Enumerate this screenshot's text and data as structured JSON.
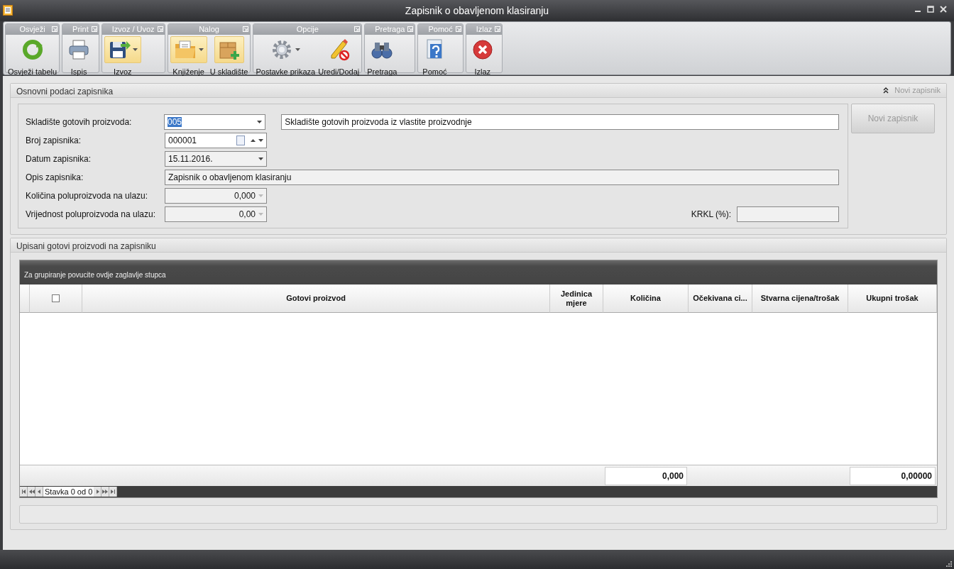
{
  "window": {
    "title": "Zapisnik o obavljenom klasiranju"
  },
  "ribbon": {
    "groups": [
      {
        "title": "Osvježi",
        "buttons": [
          {
            "label": "Osvježi tabelu",
            "kind": "refresh",
            "dropdown": false,
            "highlighted": false
          }
        ]
      },
      {
        "title": "Print",
        "buttons": [
          {
            "label": "Ispis",
            "kind": "printer",
            "dropdown": false,
            "highlighted": false
          }
        ]
      },
      {
        "title": "Izvoz / Uvoz",
        "buttons": [
          {
            "label": "Izvoz",
            "kind": "save",
            "dropdown": true,
            "highlighted": true
          }
        ]
      },
      {
        "title": "Nalog",
        "buttons": [
          {
            "label": "Knjiženje",
            "kind": "folder",
            "dropdown": true,
            "highlighted": true
          },
          {
            "label": "U skladište",
            "kind": "box",
            "dropdown": false,
            "highlighted": true
          }
        ]
      },
      {
        "title": "Opcije",
        "buttons": [
          {
            "label": "Postavke prikaza",
            "kind": "gear",
            "dropdown": true,
            "highlighted": false
          },
          {
            "label": "Uredi/Dodaj",
            "kind": "pencil",
            "dropdown": false,
            "highlighted": false
          }
        ]
      },
      {
        "title": "Pretraga",
        "buttons": [
          {
            "label": "Pretraga",
            "kind": "binoculars",
            "dropdown": false,
            "highlighted": false
          }
        ]
      },
      {
        "title": "Pomoć",
        "buttons": [
          {
            "label": "Pomoć",
            "kind": "help",
            "dropdown": false,
            "highlighted": false
          }
        ]
      },
      {
        "title": "Izlaz",
        "buttons": [
          {
            "label": "Izlaz",
            "kind": "exit",
            "dropdown": false,
            "highlighted": false
          }
        ]
      }
    ]
  },
  "header_panel": {
    "title": "Osnovni podaci zapisnika",
    "collapse_link": "Novi zapisnik",
    "fields": [
      {
        "label": "Skladište gotovih proizvoda:",
        "value": "005",
        "kind": "combo",
        "readonly": false,
        "selected": true,
        "description": "Skladište gotovih proizvoda iz vlastite proizvodnje"
      },
      {
        "label": "Broj zapisnika:",
        "value": "000001",
        "kind": "spin",
        "readonly": false,
        "selected": false
      },
      {
        "label": "Datum zapisnika:",
        "value": "15.11.2016.",
        "kind": "combo",
        "readonly": true,
        "selected": false
      },
      {
        "label": "Opis zapisnika:",
        "value": "Zapisnik o obavljenom klasiranju",
        "kind": "wide",
        "readonly": true,
        "selected": false
      },
      {
        "label": "Količina poluproizvoda na ulazu:",
        "value": "0,000",
        "kind": "number",
        "readonly": true,
        "selected": false
      },
      {
        "label": "Vrijednost poluproizvoda na ulazu:",
        "value": "0,00",
        "kind": "number",
        "readonly": true,
        "selected": false,
        "side_label": "KRKL (%):"
      }
    ],
    "new_button": {
      "label": "Novi zapisnik",
      "disabled": true
    }
  },
  "items_panel": {
    "title": "Upisani gotovi proizvodi na zapisniku",
    "group_hint": "Za grupiranje povucite ovdje zaglavlje stupca",
    "select_all": {
      "checked": false
    },
    "columns": [
      {
        "label": "Gotovi proizvod"
      },
      {
        "label": "Jedinica mjere"
      },
      {
        "label": "Količina",
        "summary": "0,000"
      },
      {
        "label": "Očekivana ci..."
      },
      {
        "label": "Stvarna cijena/trošak"
      },
      {
        "label": "Ukupni trošak",
        "summary": "0,00000"
      }
    ],
    "navigator": "Stavka 0 od 0"
  }
}
